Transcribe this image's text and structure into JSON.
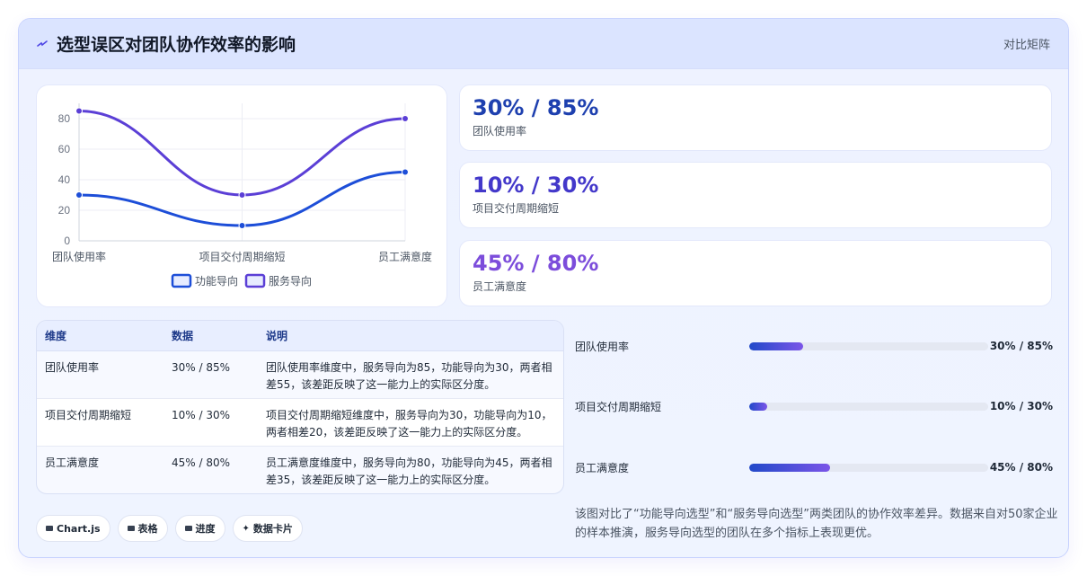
{
  "header": {
    "title": "选型误区对团队协作效率的影响",
    "right_label": "对比矩阵"
  },
  "chart_data": {
    "type": "line",
    "categories": [
      "团队使用率",
      "项目交付周期缩短",
      "员工满意度"
    ],
    "series": [
      {
        "name": "功能导向",
        "values": [
          30,
          10,
          45
        ],
        "color": "#1d4ed8"
      },
      {
        "name": "服务导向",
        "values": [
          85,
          30,
          80
        ],
        "color": "#5b3fd6"
      }
    ],
    "ylim": [
      0,
      90
    ],
    "yticks": [
      "0",
      "20",
      "40",
      "60",
      "80"
    ],
    "legend_position": "bottom",
    "grid": true
  },
  "stats": [
    {
      "value": "30% / 85%",
      "label": "团队使用率",
      "color": "#1e40af"
    },
    {
      "value": "10% / 30%",
      "label": "项目交付周期缩短",
      "color": "#4338ca"
    },
    {
      "value": "45% / 80%",
      "label": "员工满意度",
      "color": "#7c4ddb"
    }
  ],
  "table": {
    "headers": [
      "维度",
      "数据",
      "说明"
    ],
    "rows": [
      [
        "团队使用率",
        "30% / 85%",
        "团队使用率维度中，服务导向为85，功能导向为30，两者相差55，该差距反映了这一能力上的实际区分度。"
      ],
      [
        "项目交付周期缩短",
        "10% / 30%",
        "项目交付周期缩短维度中，服务导向为30，功能导向为10，两者相差20，该差距反映了这一能力上的实际区分度。"
      ],
      [
        "员工满意度",
        "45% / 80%",
        "员工满意度维度中，服务导向为80，功能导向为45，两者相差35，该差距反映了这一能力上的实际区分度。"
      ]
    ]
  },
  "progress": [
    {
      "label": "团队使用率",
      "value": "30% / 85%",
      "fill_percent": 22.5
    },
    {
      "label": "项目交付周期缩短",
      "value": "10% / 30%",
      "fill_percent": 7.5
    },
    {
      "label": "员工满意度",
      "value": "45% / 80%",
      "fill_percent": 34
    }
  ],
  "description": "该图对比了“功能导向选型”和“服务导向选型”两类团队的协作效率差异。数据来自对50家企业的样本推演，服务导向选型的团队在多个指标上表现更优。",
  "tags": [
    "Chart.js",
    "表格",
    "进度",
    "数据卡片"
  ]
}
